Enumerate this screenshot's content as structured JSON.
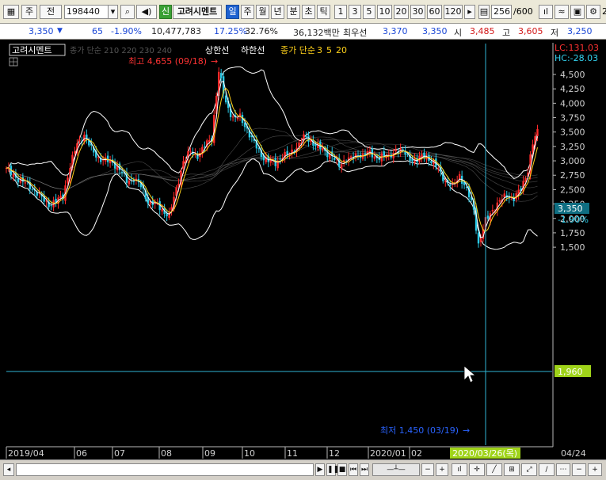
{
  "toolbar": {
    "market": "주",
    "period_label": "전",
    "code": "198440",
    "credit_badge": "신",
    "name": "고려시멘트",
    "periods": [
      "일",
      "주",
      "월",
      "년",
      "분",
      "초",
      "틱"
    ],
    "minutes": [
      "1",
      "3",
      "5",
      "10",
      "20",
      "30",
      "60",
      "120"
    ],
    "count": "256",
    "total": "/600",
    "right_digit": "2"
  },
  "quote": {
    "price": "3,350",
    "change": "65",
    "rate": "-1.90%",
    "volume": "10,477,783",
    "turnover1": "17.25%",
    "turnover2": "32.76%",
    "amount": "36,132백만",
    "best_label": "최우선",
    "ask": "3,370",
    "bid": "3,350",
    "open_label": "시",
    "open": "3,485",
    "high_label": "고",
    "high": "3,605",
    "low_label": "저",
    "low": "3,250"
  },
  "legend": {
    "name": "고려시멘트",
    "ma_dim": "종가 단순 210 220 230 240",
    "upper": "상한선",
    "lower": "하한선",
    "ma_label": "종가 단순",
    "ma_periods": [
      "3",
      "5",
      "20"
    ]
  },
  "labels": {
    "lc": "LC:131.03",
    "hc": "HC:-28.03",
    "high_note": "최고 4,655 (09/18)",
    "low_note": "최저 1,450 (03/19)",
    "cur_price": "3,350",
    "cur_rate": "-1.90%",
    "cross_price": "1,960",
    "cross_date": "2020/03/26(목)"
  },
  "colors": {
    "up": "#ff2a2a",
    "down": "#29c9e6",
    "ma3": "#ffffff",
    "ma5": "#ffd11a",
    "band": "#ffffff",
    "crosshair": "#2fb5d4",
    "cross_price_bg": "#9fd319"
  },
  "chart_data": {
    "type": "candlestick",
    "y_ticks": [
      "4,500",
      "4,250",
      "4,000",
      "3,750",
      "3,500",
      "3,250",
      "3,000",
      "2,750",
      "2,500",
      "2,250",
      "2,000",
      "1,750",
      "1,500"
    ],
    "x_ticks": [
      "2019/04",
      "06",
      "07",
      "08",
      "09",
      "10",
      "11",
      "12",
      "2020/01",
      "02",
      "04/24"
    ],
    "ylim": [
      1400,
      4700
    ],
    "price_path": [
      [
        0,
        2850
      ],
      [
        3,
        2760
      ],
      [
        6,
        2650
      ],
      [
        9,
        2600
      ],
      [
        12,
        2480
      ],
      [
        15,
        2350
      ],
      [
        18,
        2250
      ],
      [
        21,
        2280
      ],
      [
        24,
        2400
      ],
      [
        27,
        2900
      ],
      [
        30,
        3300
      ],
      [
        33,
        3450
      ],
      [
        36,
        3200
      ],
      [
        39,
        3050
      ],
      [
        42,
        3000
      ],
      [
        45,
        2980
      ],
      [
        48,
        2850
      ],
      [
        51,
        2650
      ],
      [
        54,
        2700
      ],
      [
        57,
        2550
      ],
      [
        60,
        2300
      ],
      [
        63,
        2250
      ],
      [
        66,
        2150
      ],
      [
        69,
        2050
      ],
      [
        72,
        2500
      ],
      [
        75,
        3000
      ],
      [
        78,
        3150
      ],
      [
        81,
        3100
      ],
      [
        84,
        3250
      ],
      [
        87,
        3400
      ],
      [
        90,
        4550
      ],
      [
        93,
        4000
      ],
      [
        96,
        3750
      ],
      [
        99,
        3750
      ],
      [
        102,
        3550
      ],
      [
        105,
        3300
      ],
      [
        108,
        3100
      ],
      [
        111,
        3000
      ],
      [
        114,
        2950
      ],
      [
        117,
        3100
      ],
      [
        120,
        3100
      ],
      [
        123,
        3250
      ],
      [
        126,
        3400
      ],
      [
        129,
        3350
      ],
      [
        132,
        3250
      ],
      [
        135,
        3150
      ],
      [
        138,
        3100
      ],
      [
        141,
        2900
      ],
      [
        144,
        3050
      ],
      [
        147,
        3050
      ],
      [
        150,
        3100
      ],
      [
        153,
        3150
      ],
      [
        156,
        3050
      ],
      [
        159,
        3100
      ],
      [
        162,
        3050
      ],
      [
        165,
        3200
      ],
      [
        168,
        3150
      ],
      [
        171,
        3050
      ],
      [
        174,
        3000
      ],
      [
        177,
        3100
      ],
      [
        180,
        3000
      ],
      [
        183,
        2850
      ],
      [
        186,
        2650
      ],
      [
        189,
        2550
      ],
      [
        192,
        2750
      ],
      [
        195,
        2500
      ],
      [
        198,
        2150
      ],
      [
        200,
        1550
      ],
      [
        203,
        1950
      ],
      [
        206,
        2150
      ],
      [
        209,
        2300
      ],
      [
        212,
        2400
      ],
      [
        215,
        2350
      ],
      [
        218,
        2500
      ],
      [
        221,
        2850
      ],
      [
        223,
        3300
      ],
      [
        225,
        3500
      ]
    ]
  }
}
